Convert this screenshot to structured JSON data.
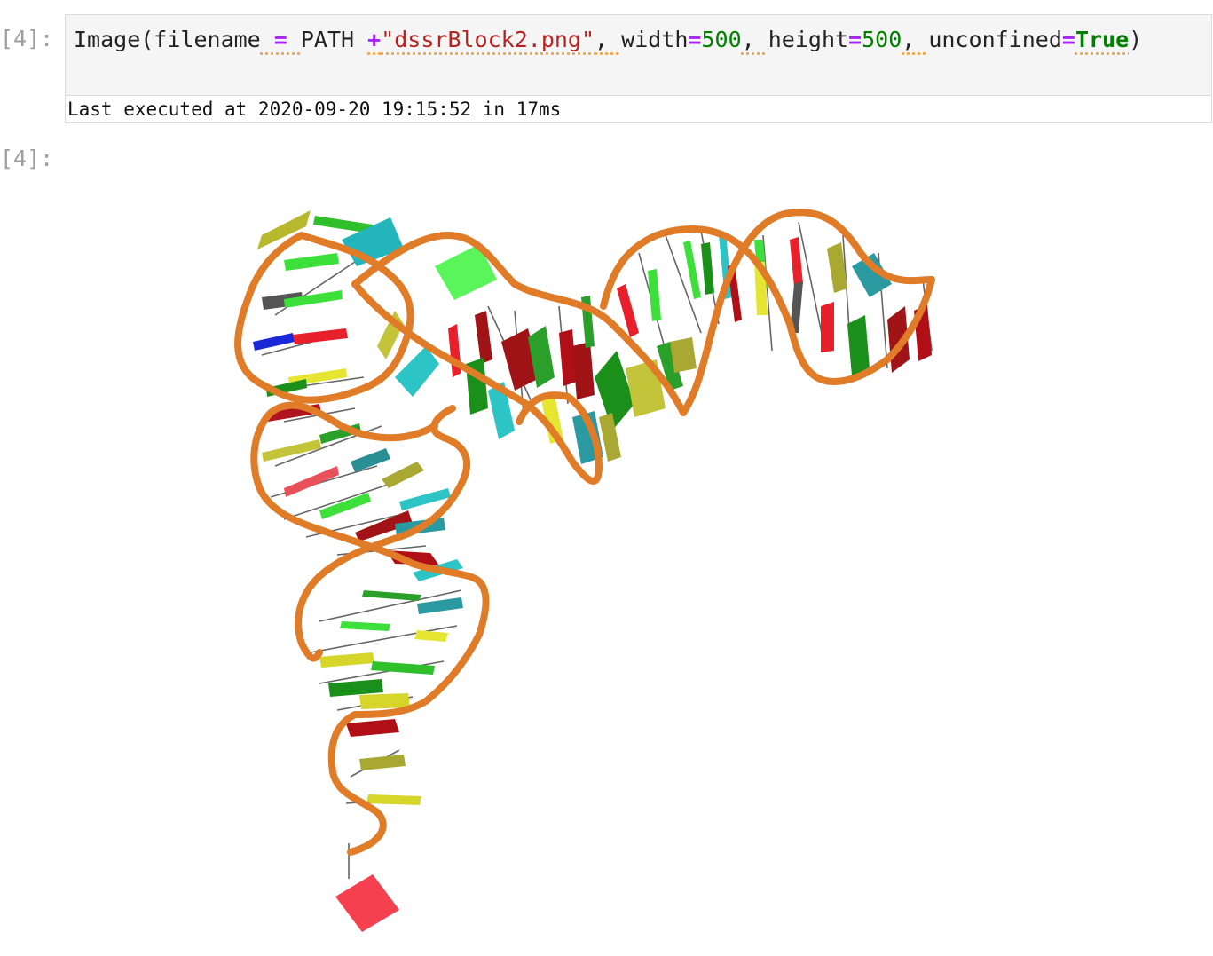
{
  "input_cell": {
    "prompt": "[4]:",
    "tokens": [
      {
        "text": "Image(filename",
        "type": "plain",
        "lint": false
      },
      {
        "text": " = ",
        "type": "op",
        "lint": true
      },
      {
        "text": "PATH ",
        "type": "plain",
        "lint": false
      },
      {
        "text": "+",
        "type": "op",
        "lint": true
      },
      {
        "text": "\"dssrBlock2.png\"",
        "type": "str",
        "lint": true
      },
      {
        "text": ", ",
        "type": "plain",
        "lint": true
      },
      {
        "text": "width",
        "type": "plain",
        "lint": false
      },
      {
        "text": "=",
        "type": "op",
        "lint": false
      },
      {
        "text": "500",
        "type": "num",
        "lint": false
      },
      {
        "text": ", ",
        "type": "plain",
        "lint": true
      },
      {
        "text": "height",
        "type": "plain",
        "lint": false
      },
      {
        "text": "=",
        "type": "op",
        "lint": false
      },
      {
        "text": "500",
        "type": "num",
        "lint": false
      },
      {
        "text": ", ",
        "type": "plain",
        "lint": true
      },
      {
        "text": "unconfined",
        "type": "plain",
        "lint": false
      },
      {
        "text": "=",
        "type": "op",
        "lint": false
      },
      {
        "text": "True",
        "type": "kw",
        "lint": true
      },
      {
        "text": ")",
        "type": "plain",
        "lint": false
      }
    ]
  },
  "exec_info": "Last executed at 2020-09-20 19:15:52 in 17ms",
  "output_cell": {
    "prompt": "[4]:"
  },
  "colors": {
    "backbone": "#e07b28",
    "green": "#3de03a",
    "dark_green": "#167a16",
    "yellow": "#d6d62a",
    "olive": "#a8a832",
    "cyan": "#2cc4c4",
    "teal": "#2a8f95",
    "red": "#e8202c",
    "dark_red": "#8f1018",
    "blue": "#1a28d8",
    "gray": "#555555"
  }
}
